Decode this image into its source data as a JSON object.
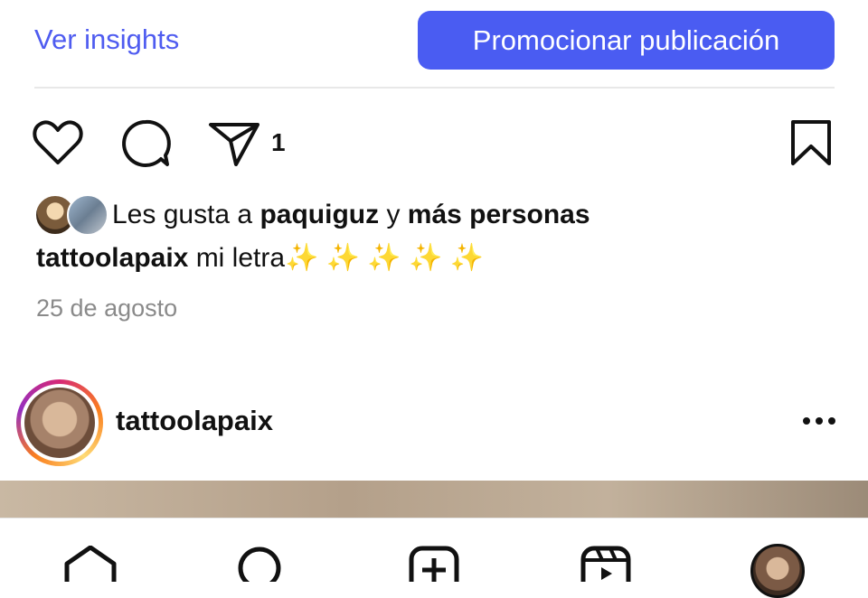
{
  "top": {
    "insights_label": "Ver insights",
    "promote_label": "Promocionar publicación"
  },
  "actions": {
    "share_count": "1",
    "icons": [
      "heart-icon",
      "comment-icon",
      "share-icon",
      "bookmark-icon"
    ]
  },
  "likes": {
    "prefix": "Les gusta a ",
    "user": "paquiguz",
    "connector": " y ",
    "others": "más personas"
  },
  "caption": {
    "user": "tattoolapaix",
    "text": " mi letra✨ ✨ ✨ ✨ ✨"
  },
  "date": "25 de agosto",
  "next_post": {
    "username": "tattoolapaix"
  },
  "colors": {
    "accent": "#4a5cf2",
    "link": "#4f5cf0"
  },
  "bottom_nav": [
    "home-icon",
    "search-icon",
    "create-icon",
    "reels-icon",
    "profile-avatar"
  ]
}
